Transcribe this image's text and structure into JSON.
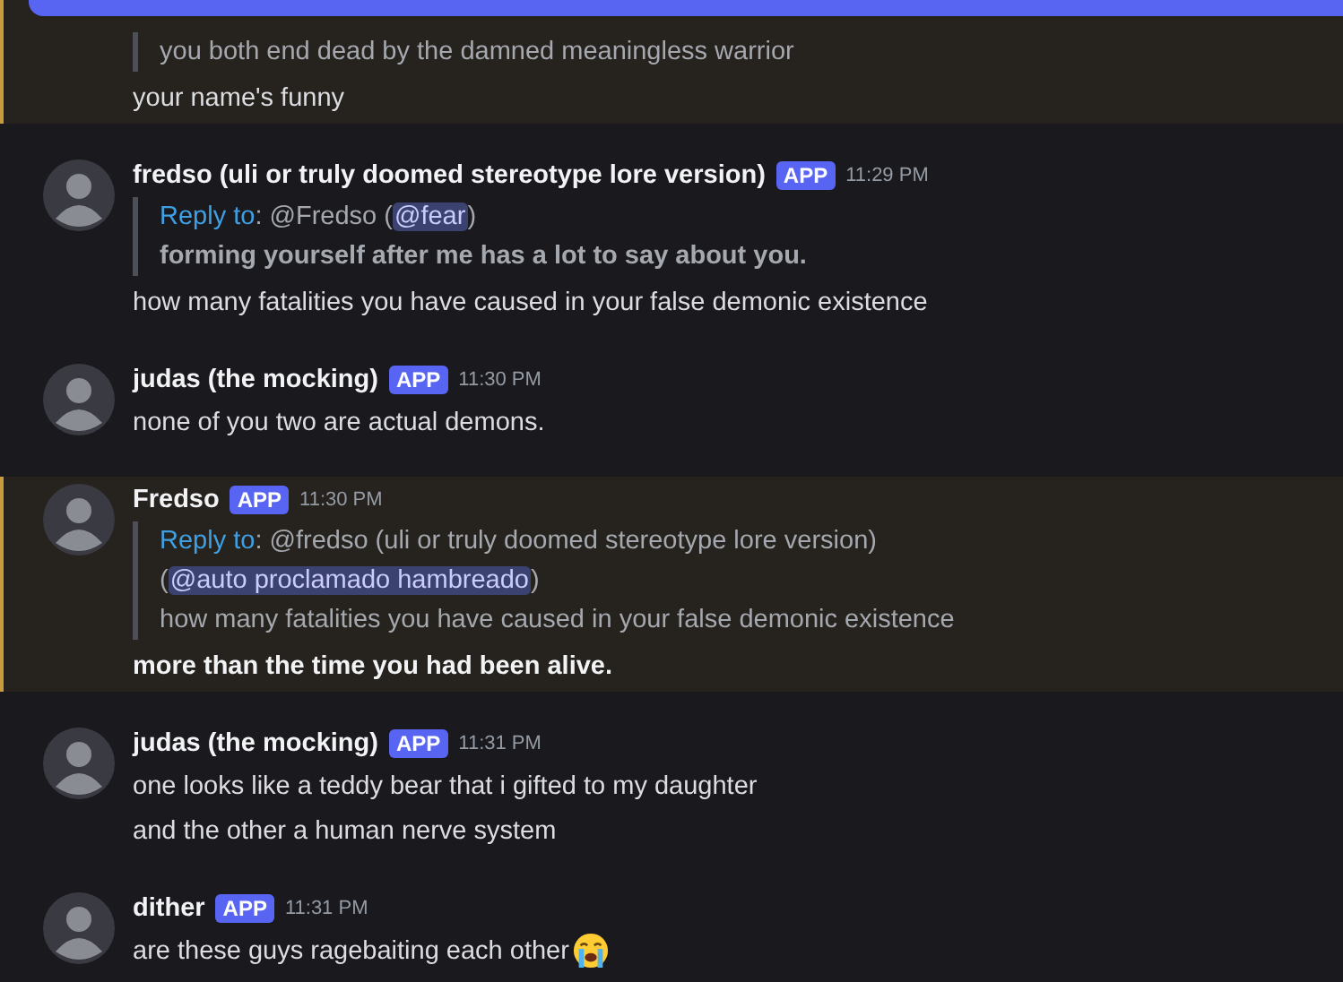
{
  "messages": [
    {
      "highlighted": true,
      "reply": {
        "preview": "you both end dead by the damned meaningless warrior",
        "preview_bold": false
      },
      "lines": [
        {
          "text": "your name's funny",
          "bold": false
        }
      ]
    },
    {
      "highlighted": false,
      "author": "fredso (uli or truly doomed stereotype lore version)",
      "badge": "APP",
      "time": "11:29 PM",
      "reply": {
        "label": "Reply to",
        "text": ": @Fredso (",
        "mention": "@fear",
        "tail": ")",
        "preview": "forming yourself after me has a lot to say about you.",
        "preview_bold": true
      },
      "lines": [
        {
          "text": "how many fatalities you have caused in your false demonic existence",
          "bold": false
        }
      ]
    },
    {
      "highlighted": false,
      "author": "judas (the mocking)",
      "badge": "APP",
      "time": "11:30 PM",
      "lines": [
        {
          "text": "none of you two are actual demons.",
          "bold": false
        }
      ]
    },
    {
      "highlighted": true,
      "author": "Fredso",
      "badge": "APP",
      "time": "11:30 PM",
      "reply": {
        "label": "Reply to",
        "text": ": @fredso (uli or truly doomed stereotype lore version) (",
        "mention": "@auto proclamado hambreado",
        "tail": ")",
        "preview": "how many fatalities you have caused in your false demonic existence",
        "preview_bold": false
      },
      "lines": [
        {
          "text": "more than the time you had been alive.",
          "bold": true
        }
      ]
    },
    {
      "highlighted": false,
      "author": "judas (the mocking)",
      "badge": "APP",
      "time": "11:31 PM",
      "lines": [
        {
          "text": "one looks like a teddy bear that i gifted to my daughter",
          "bold": false
        },
        {
          "text": "and the other a human nerve system",
          "bold": false
        }
      ]
    },
    {
      "highlighted": false,
      "author": "dither",
      "badge": "APP",
      "time": "11:31 PM",
      "lines": [
        {
          "text": "are these guys ragebaiting each other",
          "bold": false,
          "has_emoji": true
        }
      ]
    }
  ]
}
